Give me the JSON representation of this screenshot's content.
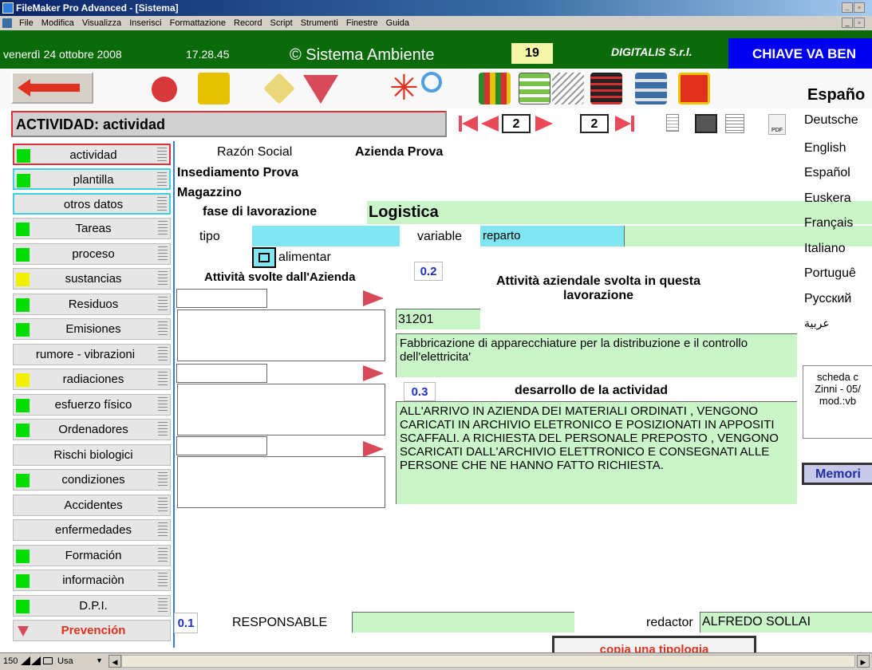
{
  "window": {
    "title": "FileMaker Pro Advanced - [Sistema]",
    "menu": [
      "File",
      "Modifica",
      "Visualizza",
      "Inserisci",
      "Formattazione",
      "Record",
      "Script",
      "Strumenti",
      "Finestre",
      "Guida"
    ]
  },
  "status": {
    "date": "venerdì 24 ottobre 2008",
    "time": "17.28.45",
    "app_name": "© Sistema Ambiente",
    "count": "19",
    "company": "DIGITALIS S.r.l.",
    "key_label": "CHIAVE VA BEN"
  },
  "toolbar": {
    "icons": [
      "back-arrow-icon",
      "print-icon",
      "files-icon",
      "diamond-icon",
      "funnel-icon",
      "asterisk-icon",
      "search-icon",
      "books-icon",
      "list-icon",
      "pages-icon",
      "film-icon",
      "tools-icon",
      "exit-icon"
    ]
  },
  "header": {
    "title": "ACTIVIDAD: actividad",
    "record_current": "2",
    "record_total": "2"
  },
  "sidebar": {
    "items": [
      {
        "label": "actividad",
        "status": "green"
      },
      {
        "label": "plantilla",
        "status": "green"
      },
      {
        "label": "otros datos",
        "status": "none"
      },
      {
        "label": "Tareas",
        "status": "green"
      },
      {
        "label": "proceso",
        "status": "green"
      },
      {
        "label": "sustancias",
        "status": "yellow"
      },
      {
        "label": "Residuos",
        "status": "green"
      },
      {
        "label": "Emisiones",
        "status": "green"
      },
      {
        "label": "rumore - vibrazioni",
        "status": "none"
      },
      {
        "label": "radiaciones",
        "status": "yellow"
      },
      {
        "label": "esfuerzo físico",
        "status": "green"
      },
      {
        "label": "Ordenadores",
        "status": "green"
      },
      {
        "label": "Rischi biologici",
        "status": "none"
      },
      {
        "label": "condiziones",
        "status": "green"
      },
      {
        "label": "Accidentes",
        "status": "none"
      },
      {
        "label": "enfermedades",
        "status": "none"
      },
      {
        "label": "Formación",
        "status": "green"
      },
      {
        "label": "informaciòn",
        "status": "green"
      },
      {
        "label": "D.P.I.",
        "status": "green"
      },
      {
        "label": "Prevención",
        "status": "red"
      }
    ]
  },
  "form": {
    "razon_social_label": "Razón Social",
    "razon_social_value": "Azienda Prova",
    "insediamento": "Insediamento Prova",
    "magazzino": "Magazzino",
    "fase_label": "fase di lavorazione",
    "fase_value": "Logistica",
    "tipo_label": "tipo",
    "tipo_value": "",
    "variable_label": "variable",
    "variable_value": "reparto",
    "alimentar_label": "alimentar",
    "attivita_svolte_label": "Attività svolte dall'Azienda",
    "num_02": "0.2",
    "attivita_aziendale_label": "Attività aziendale svolta in questa lavorazione",
    "code": "31201",
    "code_desc": "Fabbricazione di apparecchiature per la distribuzione e il controllo dell'elettricita'",
    "num_03": "0.3",
    "desarrollo_label": "desarrollo de la actividad",
    "desarrollo_text": "ALL'ARRIVO IN AZIENDA  DEI MATERIALI ORDINATI , VENGONO CARICATI IN ARCHIVIO ELETRONICO E POSIZIONATI IN APPOSITI SCAFFALI. A RICHIESTA DEL PERSONALE PREPOSTO , VENGONO SCARICATI DALL'ARCHIVIO ELETTRONICO E CONSEGNATI ALLE PERSONE CHE NE HANNO FATTO RICHIESTA.",
    "num_01": "0.1",
    "responsable_label": "RESPONSABLE",
    "responsable_value": "",
    "redactor_label": "redactor",
    "redactor_value": "ALFREDO SOLLAI",
    "copia_label": "copia una tipologia"
  },
  "languages": {
    "current": "Españo",
    "list": [
      "Deutsche",
      "English",
      "Español",
      "Euskera",
      "Français",
      "Italiano",
      "Portuguê",
      "Русский",
      "عربية"
    ]
  },
  "scheda": {
    "line1": "scheda c",
    "line2": "Zinni - 05/",
    "line3": "mod.:vb"
  },
  "memori_label": "Memori",
  "bottom": {
    "zoom": "150",
    "mode": "Usa"
  },
  "colors": {
    "status_green": "#0b6b0b",
    "field_green": "#c9f5c9",
    "field_cyan": "#7fe6f2",
    "accent_red": "#e0301e",
    "key_blue": "#0000ee"
  }
}
